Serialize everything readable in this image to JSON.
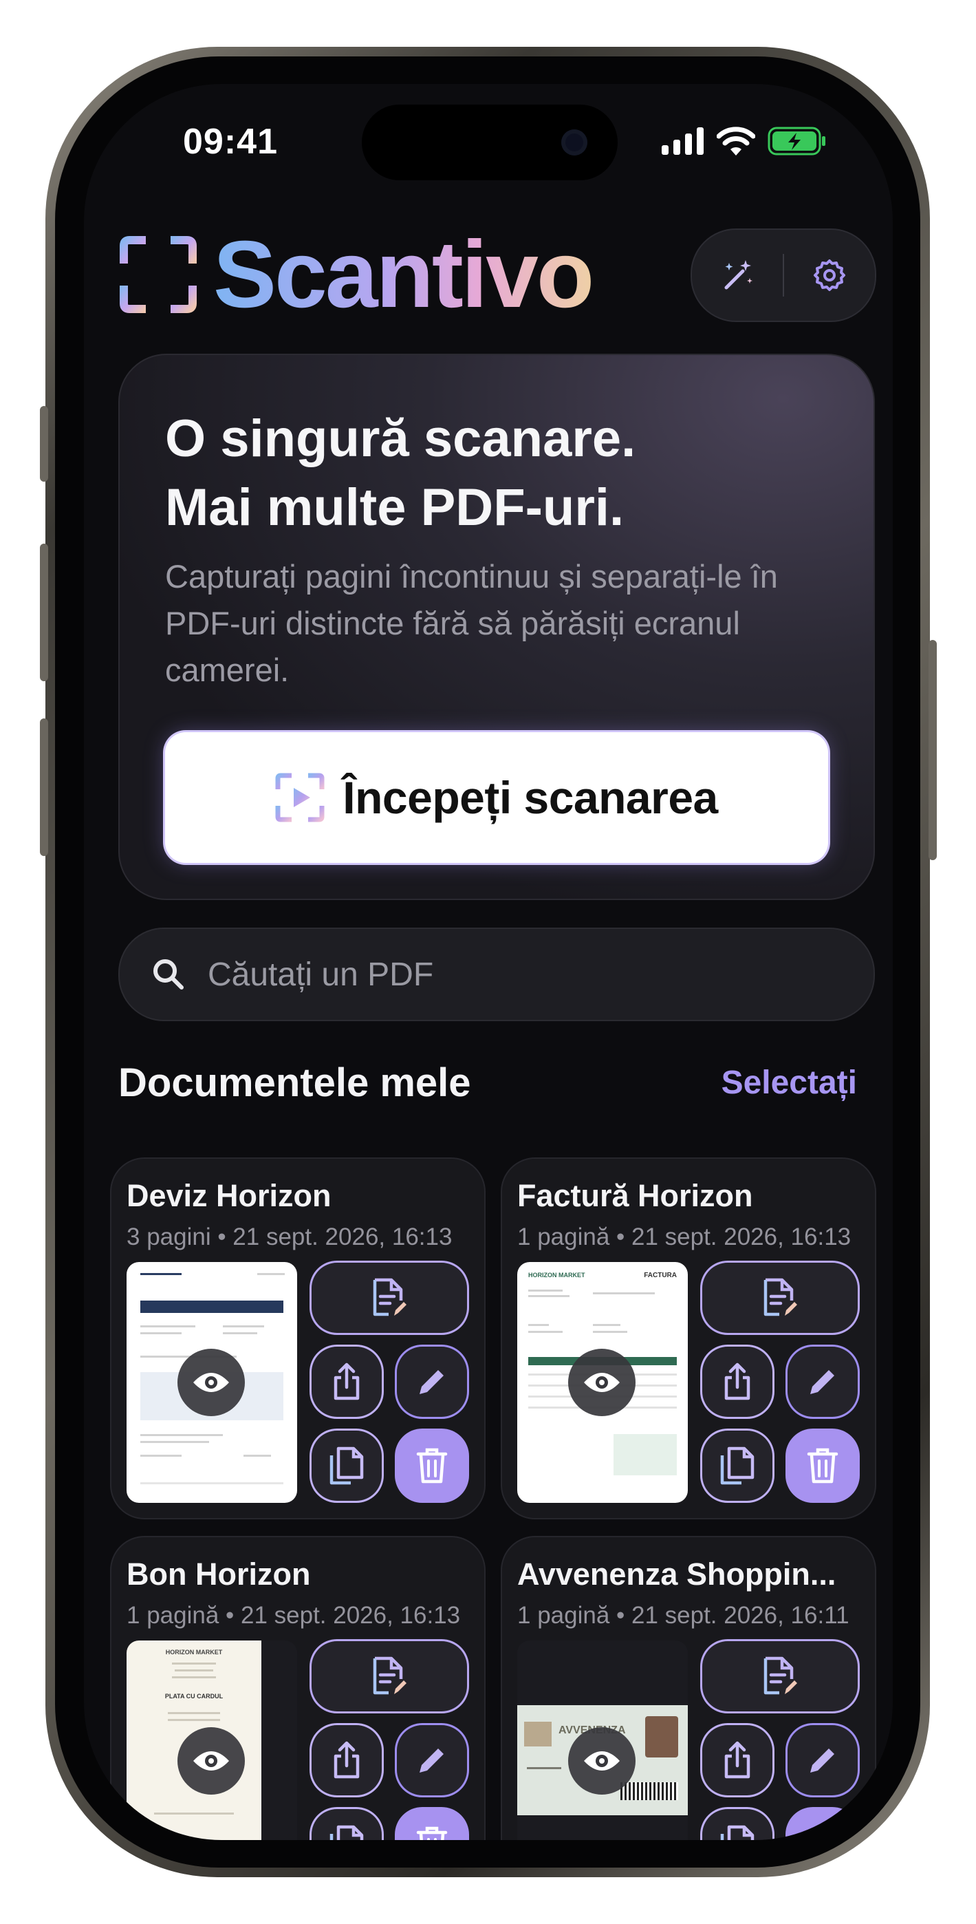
{
  "status_bar": {
    "time": "09:41"
  },
  "app": {
    "name": "Scantivo"
  },
  "hero": {
    "title_line1": "O singură scanare.",
    "title_line2": "Mai multe PDF-uri.",
    "subtitle": "Capturați pagini încontinuu și separați-le în PDF-uri distincte fără să părăsiți ecranul camerei.",
    "button_label": "Începeți scanarea"
  },
  "search": {
    "placeholder": "Căutați un PDF"
  },
  "documents": {
    "section_title": "Documentele mele",
    "select_label": "Selectați",
    "items": [
      {
        "title": "Deviz Horizon",
        "meta": "3 pagini • 21 sept. 2026, 16:13"
      },
      {
        "title": "Factură Horizon",
        "meta": "1 pagină • 21 sept. 2026, 16:13"
      },
      {
        "title": "Bon Horizon",
        "meta": "1 pagină • 21 sept. 2026, 16:13"
      },
      {
        "title": "Avvenenza Shoppin...",
        "meta": "1 pagină • 21 sept. 2026, 16:11"
      }
    ]
  },
  "thumbnails": {
    "invoice_heading": "FACTURA",
    "store_name": "HORIZON MARKET",
    "receipt_total": "PLATA CU CARDUL",
    "card_brand": "AVVENENZA"
  },
  "colors": {
    "background": "#0c0c0f",
    "accent": "#a796f2",
    "card": "#18181c",
    "delete_button": "#a792f0"
  },
  "icons": [
    "magic-wand-icon",
    "gear-icon",
    "scan-icon",
    "search-icon",
    "eye-icon",
    "document-edit-icon",
    "share-icon",
    "pencil-icon",
    "duplicate-icon",
    "trash-icon"
  ]
}
